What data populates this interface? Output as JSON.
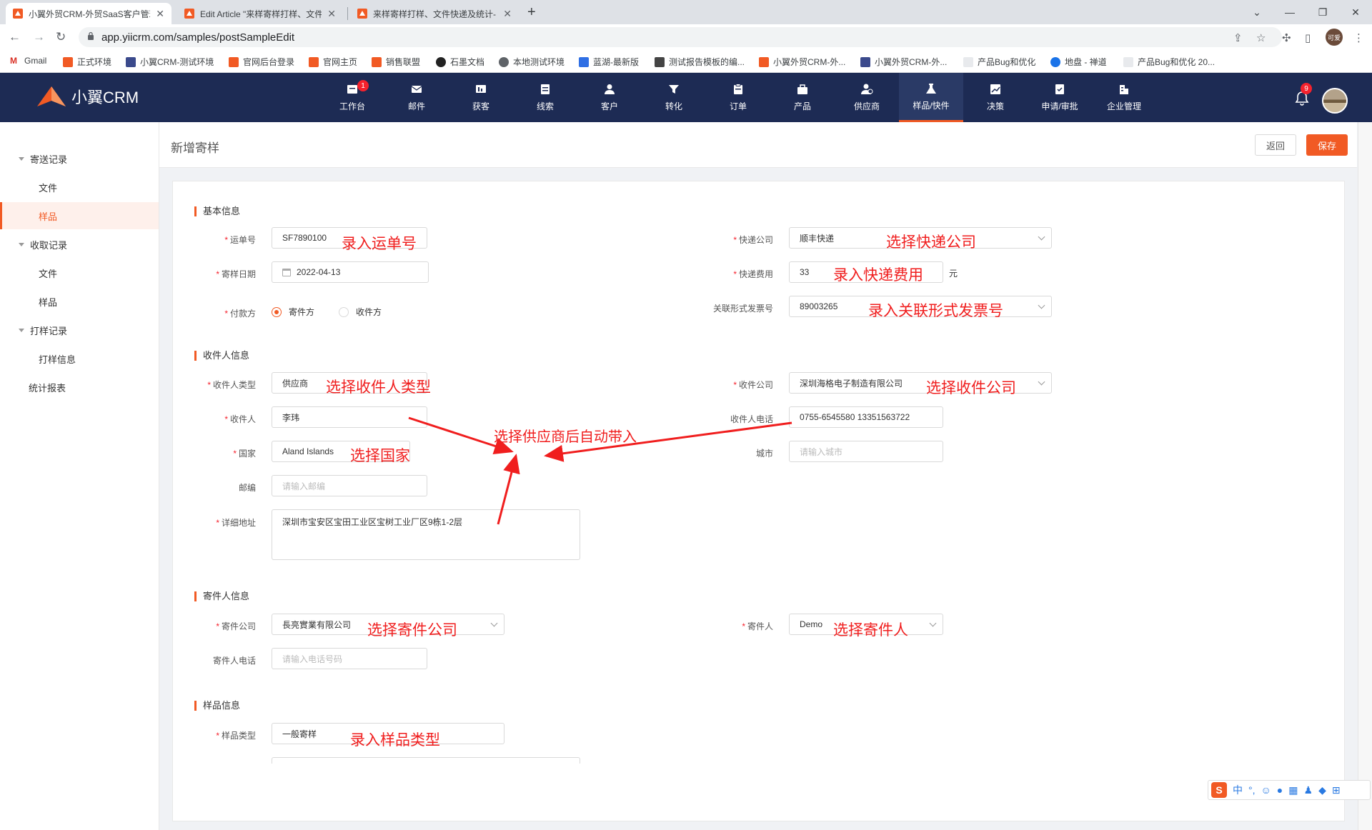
{
  "browser": {
    "tabs": [
      {
        "title": "小翼外贸CRM-外贸SaaS客户管理"
      },
      {
        "title": "Edit Article \"来样寄样打样、文件"
      },
      {
        "title": "来样寄样打样、文件快递及统计-"
      }
    ],
    "url": "app.yiicrm.com/samples/postSampleEdit",
    "profile_label": "可爱",
    "bookmarks": [
      "Gmail",
      "正式环境",
      "小翼CRM-测试环境",
      "官网后台登录",
      "官网主页",
      "销售联盟",
      "石墨文档",
      "本地测试环境",
      "蓝湖-最新版",
      "测试报告模板的编...",
      "小翼外贸CRM-外...",
      "小翼外贸CRM-外...",
      "产品Bug和优化",
      "地盘 - 禅道",
      "产品Bug和优化 20..."
    ]
  },
  "header": {
    "logo_text": "小翼CRM",
    "nav": [
      {
        "label": "工作台",
        "badge": "1"
      },
      {
        "label": "邮件"
      },
      {
        "label": "获客"
      },
      {
        "label": "线索"
      },
      {
        "label": "客户"
      },
      {
        "label": "转化"
      },
      {
        "label": "订单"
      },
      {
        "label": "产品"
      },
      {
        "label": "供应商"
      },
      {
        "label": "样品/快件",
        "active": true
      },
      {
        "label": "决策"
      },
      {
        "label": "申请/审批"
      },
      {
        "label": "企业管理"
      }
    ],
    "bell_badge": "9"
  },
  "sidebar": {
    "items": [
      {
        "label": "寄送记录",
        "type": "group"
      },
      {
        "label": "文件",
        "type": "sub"
      },
      {
        "label": "样品",
        "type": "sub",
        "active": true
      },
      {
        "label": "收取记录",
        "type": "group"
      },
      {
        "label": "文件",
        "type": "sub"
      },
      {
        "label": "样品",
        "type": "sub"
      },
      {
        "label": "打样记录",
        "type": "group"
      },
      {
        "label": "打样信息",
        "type": "sub"
      },
      {
        "label": "统计报表",
        "type": "plain"
      }
    ]
  },
  "page": {
    "title": "新增寄样",
    "back_label": "返回",
    "save_label": "保存"
  },
  "form": {
    "basic": {
      "section_title": "基本信息",
      "waybill_label": "运单号",
      "waybill_value": "SF7890100",
      "courier_label": "快递公司",
      "courier_value": "顺丰快递",
      "date_label": "寄样日期",
      "date_value": "2022-04-13",
      "fee_label": "快递费用",
      "fee_value": "33",
      "fee_unit": "元",
      "payer_label": "付款方",
      "payer_options": [
        "寄件方",
        "收件方"
      ],
      "payer_selected": "寄件方",
      "invoice_label": "关联形式发票号",
      "invoice_value": "89003265"
    },
    "recipient": {
      "section_title": "收件人信息",
      "type_label": "收件人类型",
      "type_value": "供应商",
      "company_label": "收件公司",
      "company_value": "深圳海格电子制造有限公司",
      "name_label": "收件人",
      "name_value": "李玮",
      "phone_label": "收件人电话",
      "phone_value": "0755-6545580 13351563722",
      "country_label": "国家",
      "country_value": "Aland Islands",
      "city_label": "城市",
      "city_placeholder": "请输入城市",
      "zip_label": "邮编",
      "zip_placeholder": "请输入邮编",
      "address_label": "详细地址",
      "address_value": "深圳市宝安区宝田工业区宝树工业厂区9栋1-2层"
    },
    "sender": {
      "section_title": "寄件人信息",
      "company_label": "寄件公司",
      "company_value": "長亮實業有限公司",
      "person_label": "寄件人",
      "person_value": "Demo",
      "phone_label": "寄件人电话",
      "phone_placeholder": "请输入电话号码"
    },
    "sample": {
      "section_title": "样品信息",
      "type_label": "样品类型",
      "type_value": "一般寄样"
    }
  },
  "annotations": {
    "waybill": "录入运单号",
    "courier": "选择快递公司",
    "fee": "录入快递费用",
    "invoice": "录入关联形式发票号",
    "recipient_type": "选择收件人类型",
    "recipient_company": "选择收件公司",
    "auto_fill": "选择供应商后自动带入",
    "country": "选择国家",
    "sender_company": "选择寄件公司",
    "sender_person": "选择寄件人",
    "sample_type": "录入样品类型"
  },
  "ime": {
    "lang": "中",
    "punct": "°,"
  },
  "colors": {
    "brand": "#f15a24",
    "header_bg": "#1d2b54",
    "annotation": "#f01e1e"
  }
}
